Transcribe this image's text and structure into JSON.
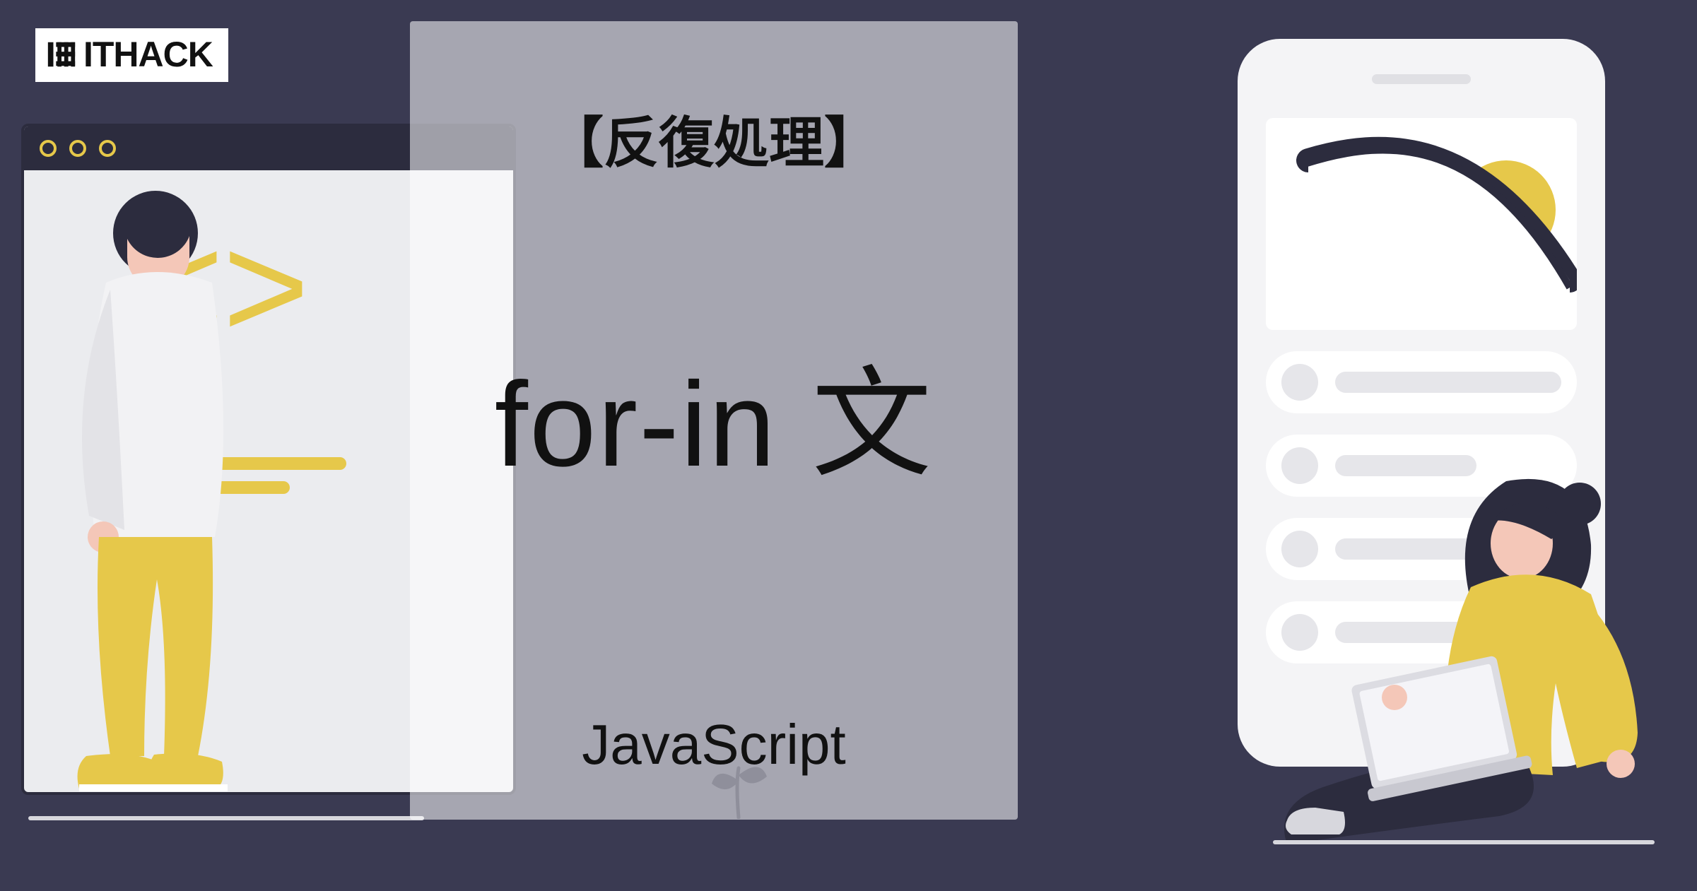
{
  "logo": {
    "text": "ITHACK"
  },
  "content": {
    "kicker": "【反復処理】",
    "title": "for-in 文",
    "language": "JavaScript"
  },
  "decor": {
    "code_bracket": "< >"
  }
}
